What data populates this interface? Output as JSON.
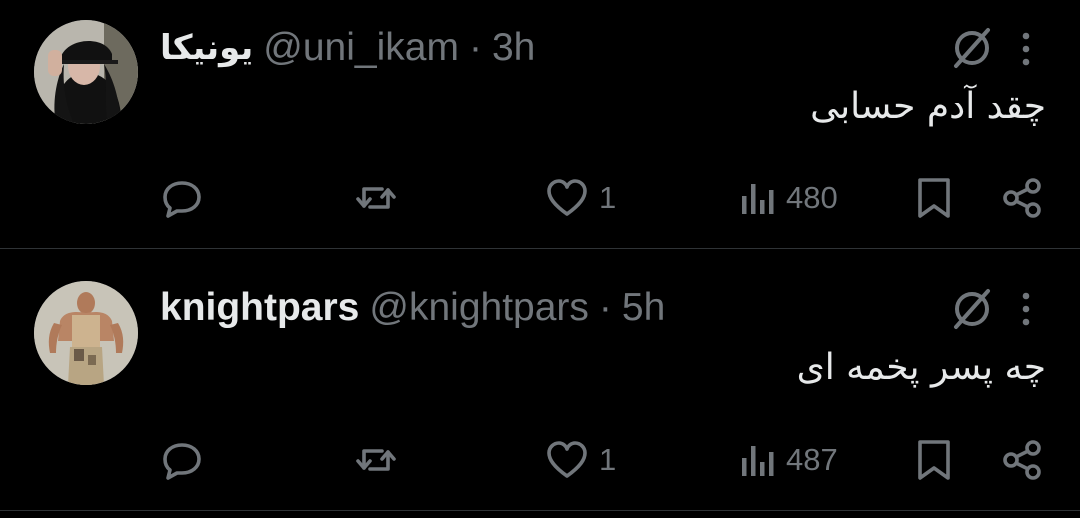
{
  "tweets": [
    {
      "display_name": "یونیکا",
      "handle": "@uni_ikam",
      "separator": "·",
      "time": "3h",
      "text": "چقد آدم حسابی",
      "likes": "1",
      "views": "480"
    },
    {
      "display_name": "knightpars",
      "handle": "@knightpars",
      "separator": "·",
      "time": "5h",
      "text": "چه پسر پخمه ای",
      "likes": "1",
      "views": "487"
    }
  ],
  "colors": {
    "background": "#000000",
    "text_primary": "#e7e9ea",
    "text_secondary": "#71767b",
    "divider": "#2f3336"
  },
  "icons": [
    "grok-icon",
    "more-icon",
    "reply-icon",
    "retweet-icon",
    "like-icon",
    "views-icon",
    "bookmark-icon",
    "share-icon"
  ]
}
